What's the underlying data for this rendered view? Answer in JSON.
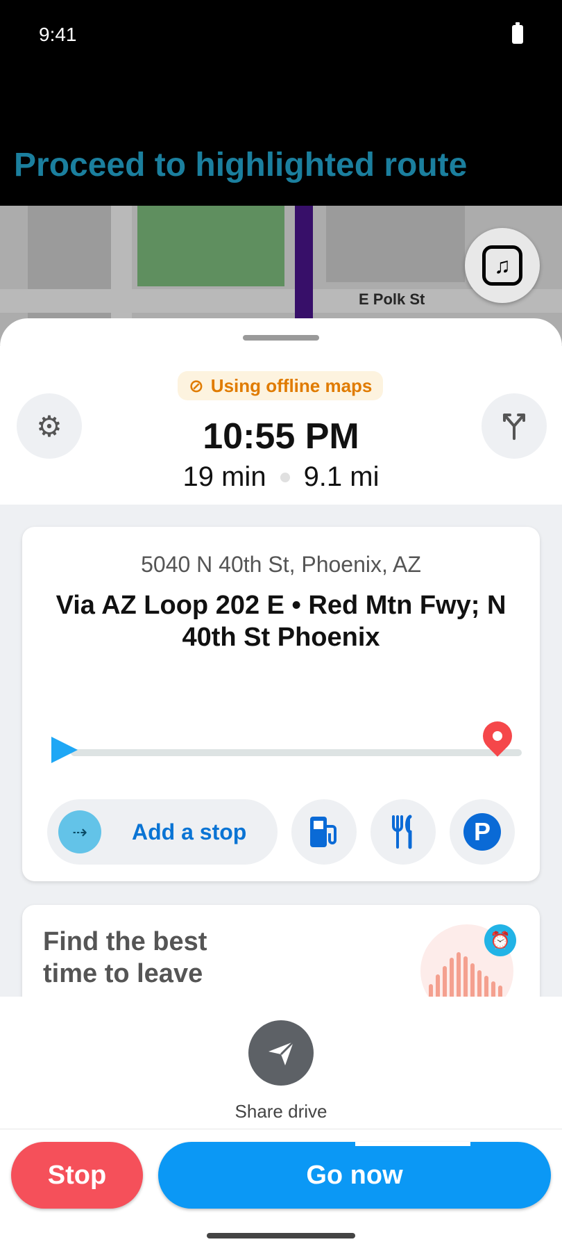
{
  "status_bar": {
    "time": "9:41"
  },
  "banner": {
    "instruction": "Proceed to highlighted route"
  },
  "map": {
    "street_label": "E Polk St"
  },
  "offline": {
    "label": "Using offline maps"
  },
  "eta": {
    "arrival_time": "10:55 PM",
    "duration": "19 min",
    "distance": "9.1 mi"
  },
  "route_card": {
    "address": "5040 N 40th St, Phoenix, AZ",
    "via": "Via AZ Loop 202 E • Red Mtn Fwy; N 40th St Phoenix",
    "add_stop_label": "Add a stop",
    "progress": 0
  },
  "leave_card": {
    "title": "Find the best time to leave"
  },
  "share": {
    "label": "Share drive"
  },
  "actions": {
    "stop_label": "Stop",
    "go_label": "Go now"
  },
  "icons": {
    "settings": "gear-icon",
    "routes": "route-fork-icon",
    "music": "music-icon",
    "gas": "gas-station-icon",
    "food": "restaurant-icon",
    "parking": "parking-icon",
    "share": "send-icon",
    "alarm": "alarm-icon"
  },
  "colors": {
    "accent_blue": "#0b98f5",
    "stop_red": "#f5505a",
    "offline_orange": "#e07b00",
    "banner_text": "#1b7f9e",
    "route_purple": "#4a148c"
  }
}
